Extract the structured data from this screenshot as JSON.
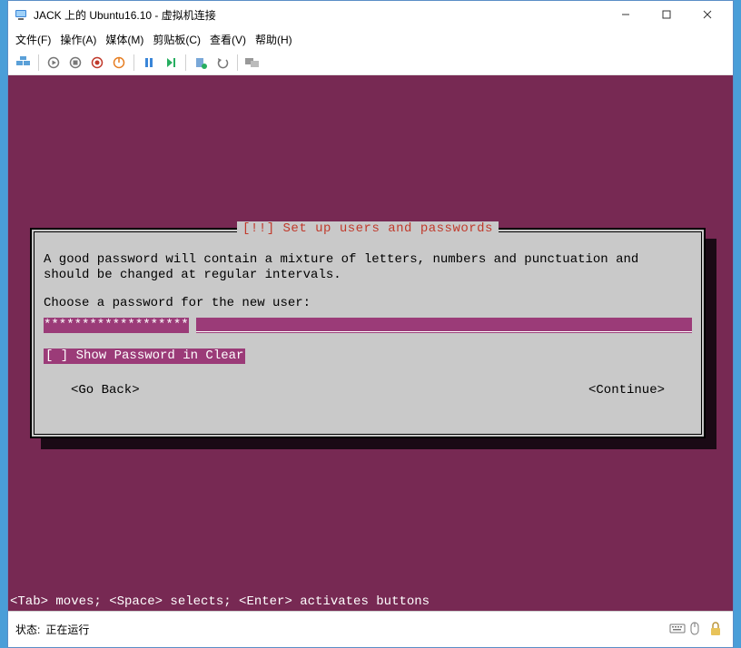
{
  "window": {
    "title": "JACK 上的 Ubuntu16.10 - 虚拟机连接"
  },
  "menu": {
    "file": "文件(F)",
    "action": "操作(A)",
    "media": "媒体(M)",
    "clipboard": "剪贴板(C)",
    "view": "查看(V)",
    "help": "帮助(H)"
  },
  "installer": {
    "title": "[!!] Set up users and passwords",
    "message": "A good password will contain a mixture of letters, numbers and punctuation and should be changed at regular intervals.",
    "prompt": "Choose a password for the new user:",
    "password_masked": "*******************",
    "show_clear": "[ ] Show Password in Clear",
    "go_back": "<Go Back>",
    "continue": "<Continue>"
  },
  "hint": "<Tab> moves; <Space> selects; <Enter> activates buttons",
  "status": {
    "label": "状态:",
    "value": "正在运行"
  }
}
